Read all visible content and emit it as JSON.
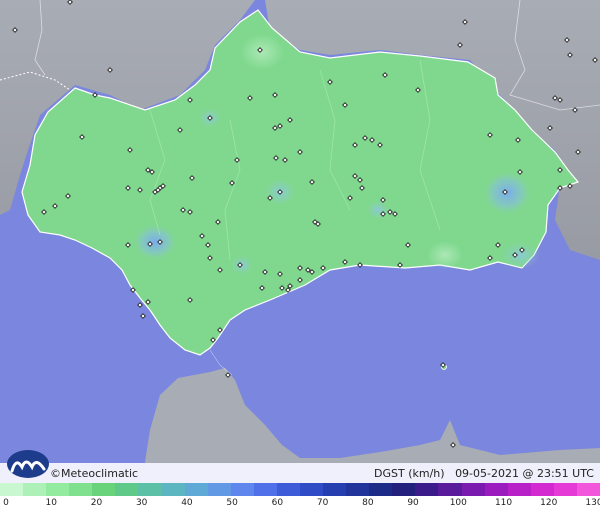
{
  "brand": {
    "name": "©Meteoclimatic",
    "logo_icon": "meteoclimatic-logo-icon"
  },
  "info": {
    "variable": "DGST (km/h)",
    "datetime": "09-05-2021 @ 23:51 UTC"
  },
  "colors": {
    "sea": "#7b86de",
    "land_outside": "#a7a9b0",
    "land_main": "#7fd88d",
    "border": "#ffffff",
    "station": "#222222"
  },
  "legend": {
    "ticks": [
      "0",
      "10",
      "20",
      "30",
      "40",
      "50",
      "60",
      "70",
      "80",
      "90",
      "100",
      "110",
      "120",
      "130"
    ],
    "colors": [
      "#c9f7d0",
      "#aef1b8",
      "#93eba0",
      "#7fe08e",
      "#69d37c",
      "#5fc98a",
      "#5bc0a6",
      "#5bb6c1",
      "#5ea9d5",
      "#6299e4",
      "#5e86ec",
      "#4f70e8",
      "#3e5cd8",
      "#2f4cc6",
      "#253fb0",
      "#20349c",
      "#1d2b88",
      "#231f7c",
      "#3b1a8a",
      "#5a1a9c",
      "#7a1aae",
      "#9b1cbe",
      "#b820c8",
      "#d22ad0",
      "#e63ad6",
      "#f257db"
    ]
  }
}
